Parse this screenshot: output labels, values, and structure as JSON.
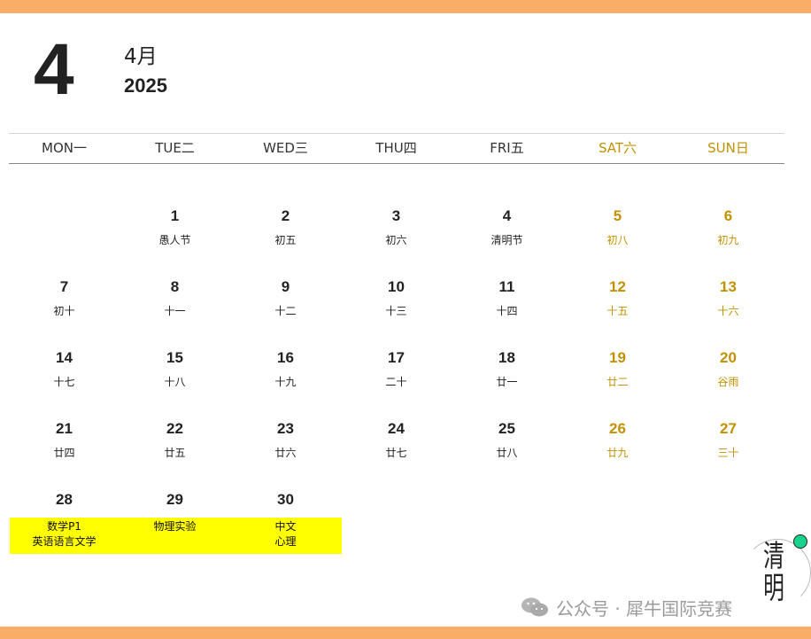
{
  "header": {
    "month_number": "4",
    "month_label": "4月",
    "year": "2025"
  },
  "colors": {
    "accent_bar": "#f9ad67",
    "weekend": "#c19100",
    "highlight": "#ffff00"
  },
  "weekdays": [
    {
      "label": "MON一",
      "weekend": false
    },
    {
      "label": "TUE二",
      "weekend": false
    },
    {
      "label": "WED三",
      "weekend": false
    },
    {
      "label": "THU四",
      "weekend": false
    },
    {
      "label": "FRI五",
      "weekend": false
    },
    {
      "label": "SAT六",
      "weekend": true
    },
    {
      "label": "SUN日",
      "weekend": true
    }
  ],
  "weeks": [
    [
      null,
      {
        "day": "1",
        "lunar": "愚人节"
      },
      {
        "day": "2",
        "lunar": "初五"
      },
      {
        "day": "3",
        "lunar": "初六"
      },
      {
        "day": "4",
        "lunar": "清明节"
      },
      {
        "day": "5",
        "lunar": "初八"
      },
      {
        "day": "6",
        "lunar": "初九"
      }
    ],
    [
      {
        "day": "7",
        "lunar": "初十"
      },
      {
        "day": "8",
        "lunar": "十一"
      },
      {
        "day": "9",
        "lunar": "十二"
      },
      {
        "day": "10",
        "lunar": "十三"
      },
      {
        "day": "11",
        "lunar": "十四"
      },
      {
        "day": "12",
        "lunar": "十五"
      },
      {
        "day": "13",
        "lunar": "十六"
      }
    ],
    [
      {
        "day": "14",
        "lunar": "十七"
      },
      {
        "day": "15",
        "lunar": "十八"
      },
      {
        "day": "16",
        "lunar": "十九"
      },
      {
        "day": "17",
        "lunar": "二十"
      },
      {
        "day": "18",
        "lunar": "廿一"
      },
      {
        "day": "19",
        "lunar": "廿二"
      },
      {
        "day": "20",
        "lunar": "谷雨"
      }
    ],
    [
      {
        "day": "21",
        "lunar": "廿四"
      },
      {
        "day": "22",
        "lunar": "廿五"
      },
      {
        "day": "23",
        "lunar": "廿六"
      },
      {
        "day": "24",
        "lunar": "廿七"
      },
      {
        "day": "25",
        "lunar": "廿八"
      },
      {
        "day": "26",
        "lunar": "廿九"
      },
      {
        "day": "27",
        "lunar": "三十"
      }
    ],
    [
      {
        "day": "28",
        "lunar": ""
      },
      {
        "day": "29",
        "lunar": ""
      },
      {
        "day": "30",
        "lunar": ""
      },
      null,
      null,
      null,
      null
    ]
  ],
  "notes": [
    [
      "数学P1",
      "英语语言文学"
    ],
    [
      "物理实验"
    ],
    [
      "中文",
      "心理"
    ]
  ],
  "watermark": {
    "text": "公众号 · 犀牛国际竞赛",
    "icon": "wechat-icon"
  },
  "logo": {
    "chars": [
      "清",
      "明"
    ]
  }
}
